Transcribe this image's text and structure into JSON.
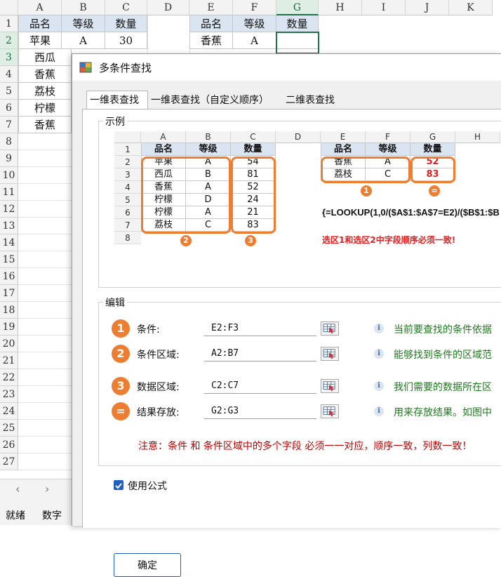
{
  "sheet": {
    "columns": [
      "A",
      "B",
      "C",
      "D",
      "E",
      "F",
      "G",
      "H",
      "I",
      "J",
      "K"
    ],
    "rows": [
      "1",
      "2",
      "3",
      "4",
      "5",
      "6",
      "7",
      "8",
      "9",
      "10",
      "11",
      "12",
      "13",
      "14",
      "15",
      "16",
      "17",
      "18",
      "19",
      "20",
      "21",
      "22",
      "23",
      "24",
      "25",
      "26",
      "27"
    ],
    "cells": {
      "A1": "品名",
      "B1": "等级",
      "C1": "数量",
      "A2": "苹果",
      "B2": "A",
      "C2": "30",
      "A3": "西瓜",
      "A4": "香蕉",
      "A5": "荔枝",
      "A6": "柠檬",
      "A7": "香蕉",
      "E1": "品名",
      "F1": "等级",
      "G1": "数量",
      "E2": "香蕉",
      "F2": "A"
    },
    "status": {
      "ready": "就绪",
      "mode": "数字"
    }
  },
  "dialog": {
    "title": "多条件查找",
    "tabs": [
      "一维表查找",
      "一维表查找（自定义顺序）",
      "二维表查找"
    ],
    "example": {
      "group_label": "示例",
      "columns": [
        "A",
        "B",
        "C",
        "D",
        "E",
        "F",
        "G",
        "H"
      ],
      "rows": [
        "1",
        "2",
        "3",
        "4",
        "5",
        "6",
        "7",
        "8"
      ],
      "source_header": [
        "品名",
        "等级",
        "数量"
      ],
      "source_rows": [
        [
          "苹果",
          "A",
          "54"
        ],
        [
          "西瓜",
          "B",
          "81"
        ],
        [
          "香蕉",
          "A",
          "52"
        ],
        [
          "柠檬",
          "D",
          "24"
        ],
        [
          "柠檬",
          "A",
          "21"
        ],
        [
          "荔枝",
          "C",
          "83"
        ]
      ],
      "result_header": [
        "品名",
        "等级",
        "数量"
      ],
      "result_rows": [
        [
          "香蕉",
          "A",
          "52"
        ],
        [
          "荔枝",
          "C",
          "83"
        ]
      ],
      "badge_labels": [
        "1",
        "2",
        "3",
        "="
      ],
      "formula": "{=LOOKUP(1,0/($A$1:$A$7=E2)/($B$1:$B",
      "note": "选区1和选区2中字段顺序必须一致!"
    },
    "edit": {
      "group_label": "编辑",
      "fields": [
        {
          "badge": "1",
          "label": "条件:",
          "value": "E2:F3",
          "hint": "当前要查找的条件依据"
        },
        {
          "badge": "2",
          "label": "条件区域:",
          "value": "A2:B7",
          "hint": "能够找到条件的区域范"
        },
        {
          "badge": "3",
          "label": "数据区域:",
          "value": "C2:C7",
          "hint": "我们需要的数据所在区"
        },
        {
          "badge": "=",
          "label": "结果存放:",
          "value": "G2:G3",
          "hint": "用来存放结果。如图中"
        }
      ],
      "warning": "注意：条件 和 条件区域中的多个字段 必须一一对应，顺序一致，列数一致！"
    },
    "use_formula_label": "使用公式",
    "ok_label": "确定"
  },
  "colors": {
    "accent": "#ed7d31",
    "excel_green": "#217346",
    "hint_green": "#1f7a1f",
    "warn_red": "#c00000",
    "header_fill": "#dbe5f1"
  }
}
